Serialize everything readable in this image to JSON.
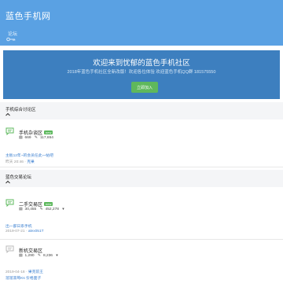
{
  "header": {
    "site_title": "蓝色手机网",
    "nav_link": "论坛",
    "icon": "key-icon",
    "bg_color": "#5aa1e3"
  },
  "banner": {
    "title": "欢迎来到忧郁的蓝色手机社区",
    "subtitle": "2018年蓝色手机社区全新改版！欢迎各位体验 欢迎蓝色手机QQ群 181575550",
    "join_label": "立即加入",
    "bg_color": "#3d7fbf"
  },
  "sections": [
    {
      "title": "手机综合讨论区",
      "forums": [
        {
          "name": "手机杂谈区",
          "badge": "new",
          "threads": "669",
          "posts": "117,654",
          "last_line1": "主板12年~的会员任此一帖吧",
          "last_date": "昨天 20:46",
          "last_user": "克果"
        }
      ]
    },
    {
      "title": "蓝色交易论坛",
      "forums": [
        {
          "name": "二手交易区",
          "badge": "new",
          "threads": "30,455",
          "posts": "452,278",
          "last_line1": "出一部日系手机",
          "last_date": "2019-07-21",
          "last_user": "alex051T"
        },
        {
          "name": "新机交易区",
          "badge": "",
          "threads": "1,290",
          "posts": "8,236",
          "last_line1": "溜溜黑莓Ks 价格面子",
          "last_date": "2019-04-18",
          "last_user": "果克前王"
        }
      ]
    }
  ]
}
